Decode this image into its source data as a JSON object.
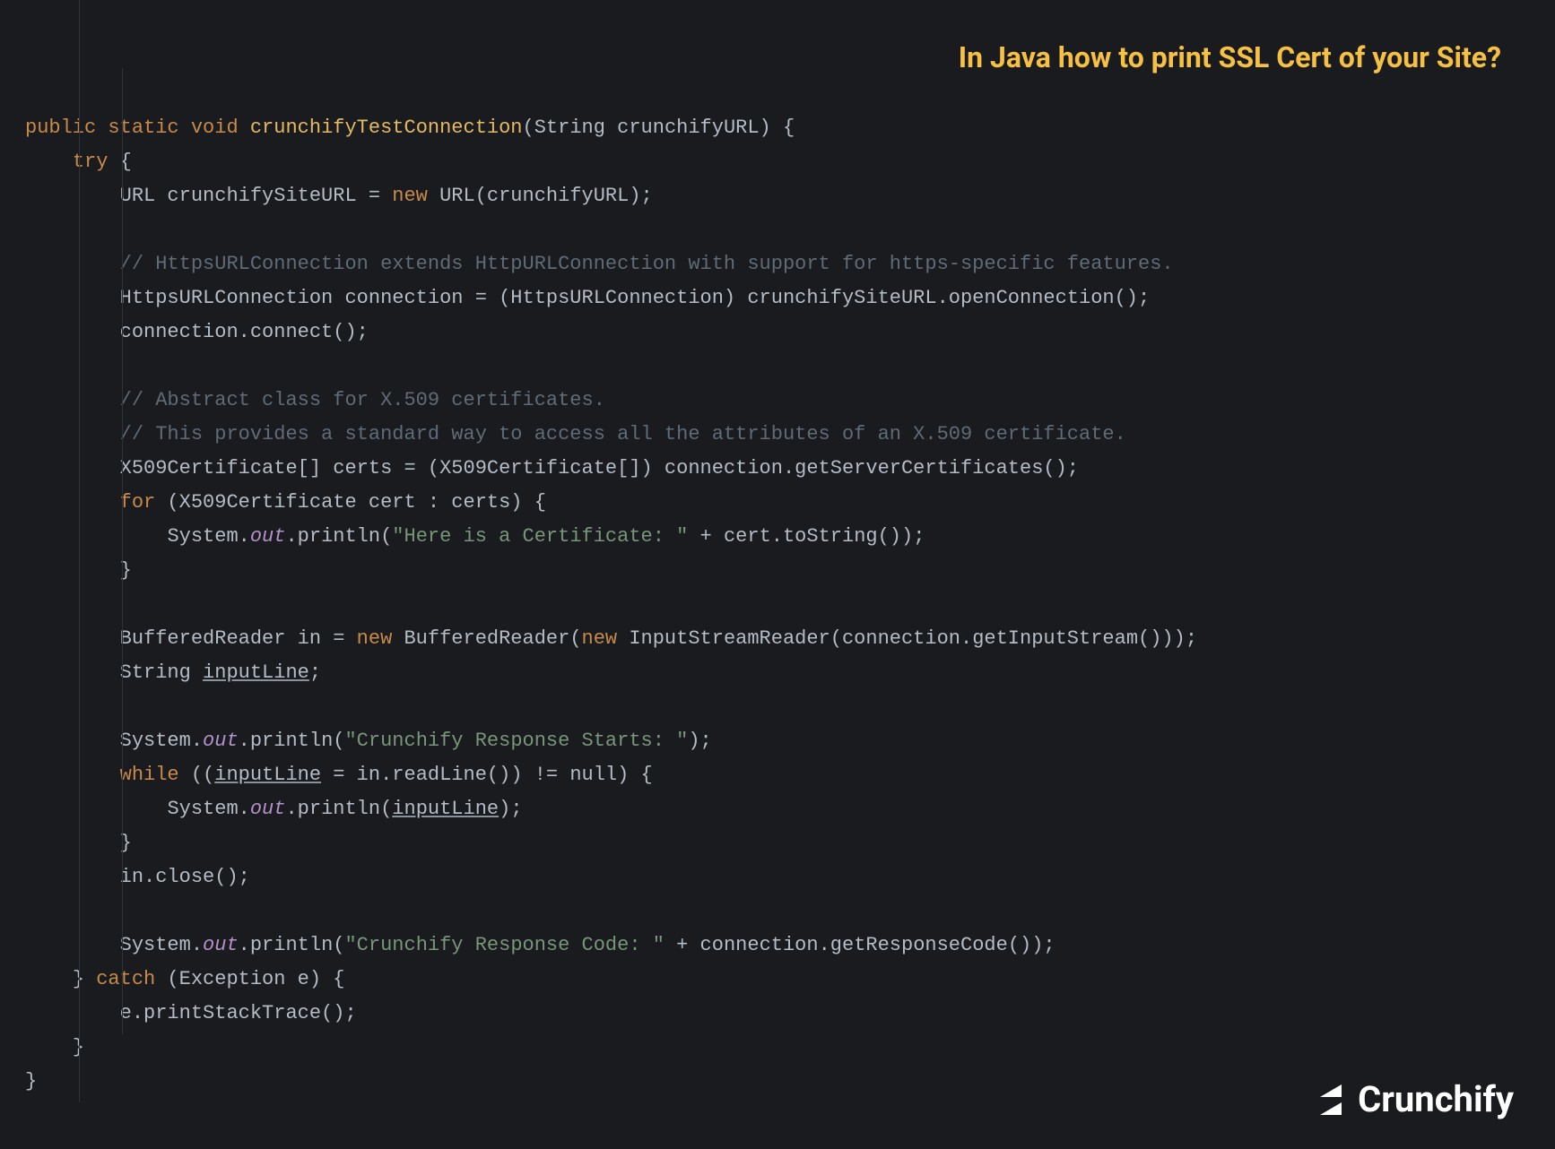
{
  "heading": "In Java how to print SSL Cert of your Site?",
  "logo_text": "Crunchify",
  "code": {
    "l01": {
      "kw1": "public",
      "kw2": "static",
      "kw3": "void",
      "method": "crunchifyTestConnection",
      "rest": "(String crunchifyURL) {"
    },
    "l02": {
      "kw": "try",
      "rest": " {"
    },
    "l03": {
      "a": "URL crunchifySiteURL = ",
      "kw": "new",
      "b": " URL(crunchifyURL);"
    },
    "l04": "",
    "l05": "// HttpsURLConnection extends HttpURLConnection with support for https-specific features.",
    "l06": "HttpsURLConnection connection = (HttpsURLConnection) crunchifySiteURL.openConnection();",
    "l07": "connection.connect();",
    "l08": "",
    "l09": "// Abstract class for X.509 certificates.",
    "l10": "// This provides a standard way to access all the attributes of an X.509 certificate.",
    "l11": "X509Certificate[] certs = (X509Certificate[]) connection.getServerCertificates();",
    "l12": {
      "kw": "for",
      "rest": " (X509Certificate cert : certs) {"
    },
    "l13": {
      "a": "System.",
      "field": "out",
      "b": ".println(",
      "str": "\"Here is a Certificate: \"",
      "c": " + cert.toString());"
    },
    "l14": "}",
    "l15": "",
    "l16": {
      "a": "BufferedReader in = ",
      "kw1": "new",
      "b": " BufferedReader(",
      "kw2": "new",
      "c": " InputStreamReader(connection.getInputStream()));"
    },
    "l17": {
      "a": "String ",
      "u": "inputLine",
      "b": ";"
    },
    "l18": "",
    "l19": {
      "a": "System.",
      "field": "out",
      "b": ".println(",
      "str": "\"Crunchify Response Starts: \"",
      "c": ");"
    },
    "l20": {
      "kw": "while",
      "a": " ((",
      "u": "inputLine",
      "b": " = in.readLine()) != null) {"
    },
    "l21": {
      "a": "System.",
      "field": "out",
      "b": ".println(",
      "u": "inputLine",
      "c": ");"
    },
    "l22": "}",
    "l23": "in.close();",
    "l24": "",
    "l25": {
      "a": "System.",
      "field": "out",
      "b": ".println(",
      "str": "\"Crunchify Response Code: \"",
      "c": " + connection.getResponseCode());"
    },
    "l26": {
      "a": "} ",
      "kw": "catch",
      "b": " (Exception e) {"
    },
    "l27": "e.printStackTrace();",
    "l28": "}",
    "l29": "}"
  }
}
